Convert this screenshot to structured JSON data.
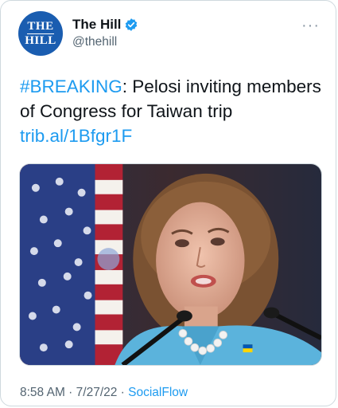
{
  "tweet": {
    "author_name": "The Hill",
    "author_handle": "@thehill",
    "avatar_text_line1": "THE",
    "avatar_text_line2": "HILL",
    "more_glyph": "···",
    "hashtag": "#BREAKING",
    "body_text": ": Pelosi inviting members of Congress for Taiwan trip ",
    "link_text": "trib.al/1Bfgr1F",
    "time": "8:58 AM",
    "separator": " · ",
    "date": "7/27/22",
    "source": "SocialFlow",
    "media_description_icon": "photo-of-speaker-at-podium"
  },
  "colors": {
    "accent": "#1d9bf0",
    "brand": "#1a5db0",
    "secondary_text": "#536471"
  }
}
